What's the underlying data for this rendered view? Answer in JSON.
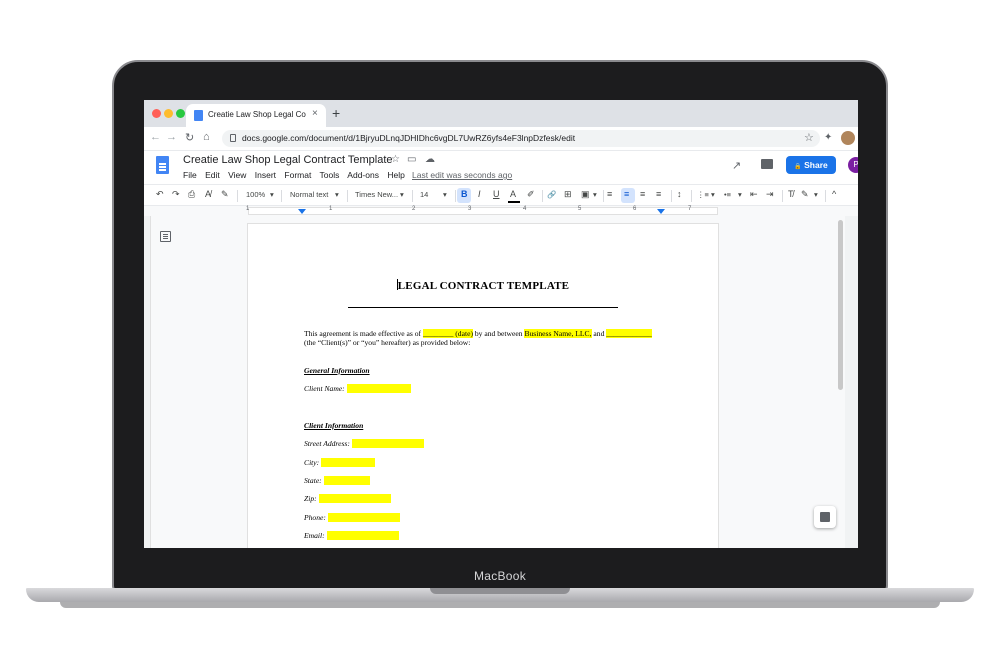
{
  "laptop": {
    "brand_label": "MacBook"
  },
  "browser": {
    "tab_title": "Creatie Law Shop Legal Contra",
    "tab_close": "×",
    "new_tab": "+",
    "url": "docs.google.com/document/d/1BjryuDLnqJDHIDhc6vgDL7UwRZ6yfs4eF3lnpDzfesk/edit",
    "back": "←",
    "forward": "→",
    "reload": "↻",
    "home": "⌂",
    "star": "☆",
    "extensions": "✦"
  },
  "docs": {
    "title": "Creatie Law Shop Legal Contract Template",
    "menu": [
      "File",
      "Edit",
      "View",
      "Insert",
      "Format",
      "Tools",
      "Add-ons",
      "Help"
    ],
    "last_edit": "Last edit was seconds ago",
    "share_label": "Share",
    "share_icon": "🔒",
    "account_initial": "P",
    "star_icon": "☆",
    "move_icon": "▭",
    "cloud_icon": "☁",
    "trend_icon": "↗"
  },
  "toolbar": {
    "undo": "↶",
    "redo": "↷",
    "print": "⎙",
    "spell": "A̸",
    "paint": "✎",
    "zoom": "100%",
    "style": "Normal text",
    "font": "Times New...",
    "size": "14",
    "bold": "B",
    "italic": "I",
    "underline": "U",
    "text_color": "A",
    "highlight": "✐",
    "link": "🔗",
    "comment": "⊞",
    "image": "▣",
    "align_left": "≡",
    "align_center": "≡",
    "align_right": "≡",
    "justify": "≡",
    "line_spacing": "↕",
    "numbered_list": "⋮≡",
    "bulleted_list": "•≡",
    "decrease_indent": "⇤",
    "increase_indent": "⇥",
    "clear_format": "T̸",
    "editing": "✎",
    "collapse": "^",
    "dropdown": "▾"
  },
  "ruler": {
    "numbers": [
      "1",
      "1",
      "2",
      "3",
      "4",
      "5",
      "6",
      "7"
    ]
  },
  "document": {
    "heading": "LEGAL CONTRACT TEMPLATE",
    "intro": {
      "p1": "This agreement is made effective as of ",
      "date": "________ (date)",
      "p2": " by and between ",
      "business": "Business Name, LLC,",
      "p3": " and ",
      "party": "____________",
      "line2": "(the “Client(s)” or “you” hereafter) as provided below:"
    },
    "section_general": "General Information",
    "client_name": "Client Name:",
    "section_client": "Client Information",
    "fields": [
      "Street Address:",
      "City:",
      "State:",
      "Zip:",
      "Phone:",
      "Email:"
    ]
  },
  "colors": {
    "accent": "#1a73e8",
    "highlight": "#ffff00",
    "avatar": "#7b1fa2",
    "docs_blue": "#4285f4"
  }
}
